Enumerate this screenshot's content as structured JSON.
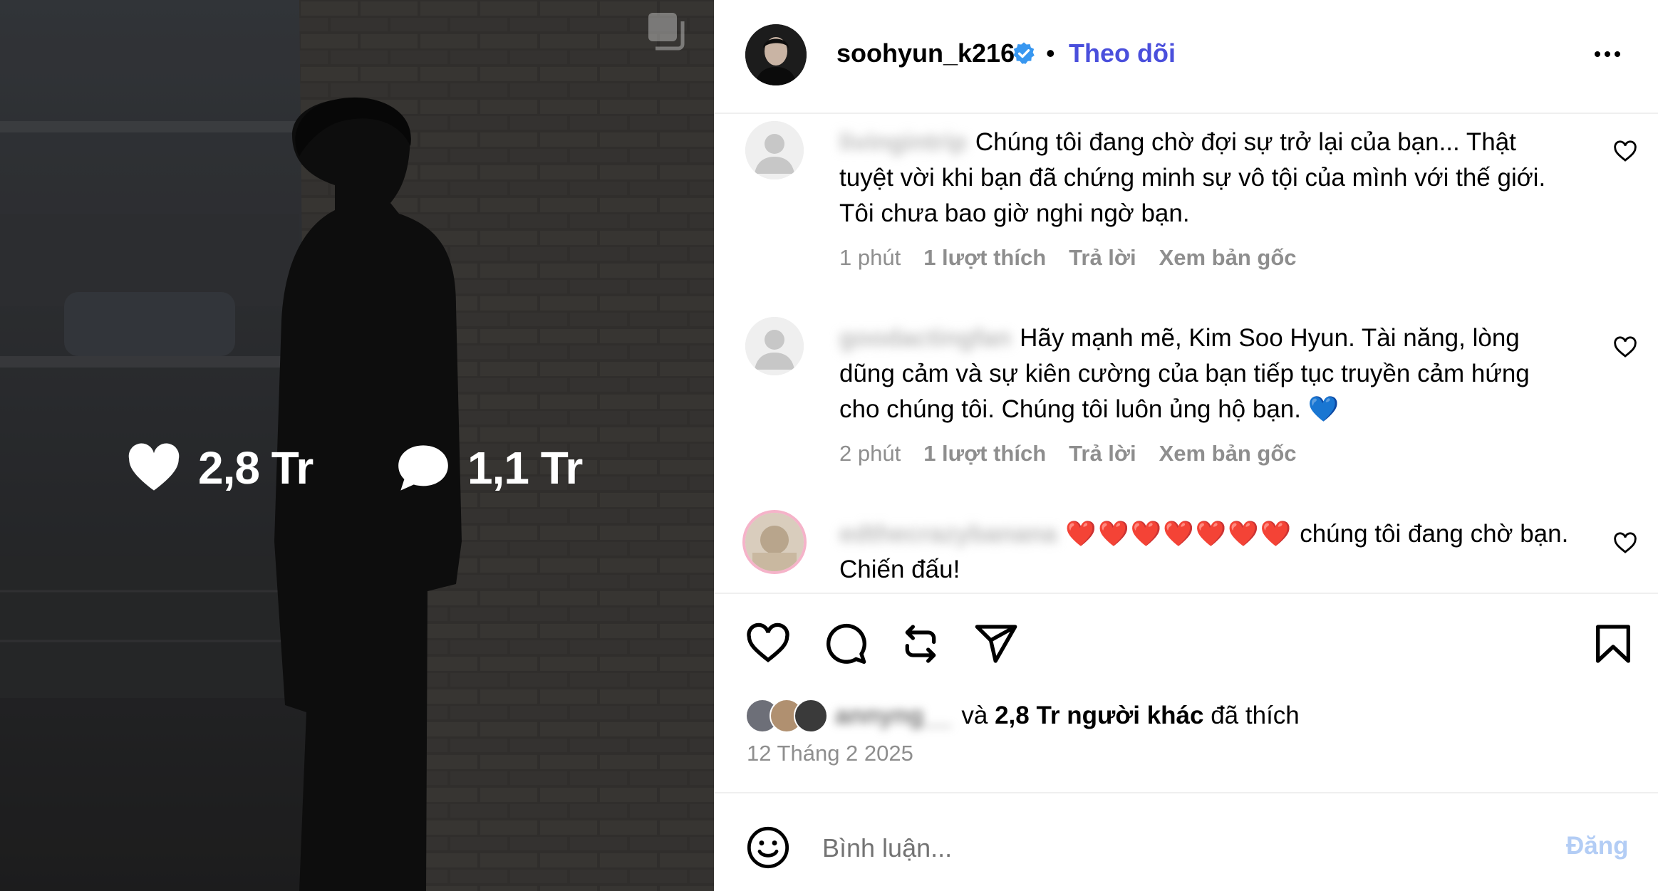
{
  "photo": {
    "likes_count": "2,8 Tr",
    "comments_count": "1,1 Tr"
  },
  "header": {
    "username": "soohyun_k216",
    "separator": "•",
    "follow_label": "Theo dõi"
  },
  "comments": [
    {
      "username": "livingintrip",
      "text": "Chúng tôi đang chờ đợi sự trở lại của bạn... Thật tuyệt vời khi bạn đã chứng minh sự vô tội của mình với thế giới. Tôi chưa bao giờ nghi ngờ bạn.",
      "time": "1 phút",
      "likes": "1 lượt thích",
      "reply": "Trả lời",
      "see_original": "Xem bản gốc"
    },
    {
      "username": "goodactingfan",
      "text": "Hãy mạnh mẽ, Kim Soo Hyun. Tài năng, lòng dũng cảm và sự kiên cường của bạn tiếp tục truyền cảm hứng cho chúng tôi. Chúng tôi luôn ủng hộ bạn.",
      "emoji": "💙",
      "time": "2 phút",
      "likes": "1 lượt thích",
      "reply": "Trả lời",
      "see_original": "Xem bản gốc"
    },
    {
      "username": "edthecrazybanana",
      "emoji": "❤️❤️❤️❤️❤️❤️❤️",
      "text": "chúng tôi đang chờ bạn. Chiến đấu!"
    }
  ],
  "likes": {
    "liker_name": "annyng__",
    "and": "và",
    "others": "2,8 Tr người khác",
    "suffix": "đã thích"
  },
  "date": "12 Tháng 2 2025",
  "comment_box": {
    "placeholder": "Bình luận...",
    "post_label": "Đăng"
  },
  "colors": {
    "follow": "#4a4fdc",
    "verified": "#3897f0",
    "post_disabled": "#b3cdf5",
    "muted": "#8e8e8e"
  }
}
